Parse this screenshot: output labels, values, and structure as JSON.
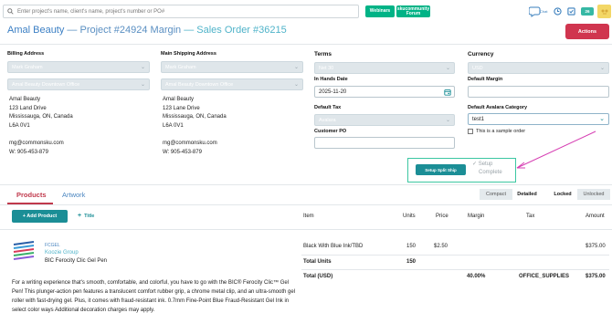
{
  "topbar": {
    "search_placeholder": "Enter project's name, client's name, project's number or PO#",
    "webinars_label": "Webinars",
    "community_label": "skucommunity Forum",
    "chat_label": "Chat",
    "badge_count": "26"
  },
  "header": {
    "client": "Amal Beauty",
    "project": " — Project #24924 Margin",
    "sales_order": " — Sales Order #36215",
    "actions_label": "Actions"
  },
  "billing": {
    "label": "Billing Address",
    "contact": "Mark Graham",
    "office": "Amal Beauty Downtown Office",
    "address": [
      "Amal Beauty",
      "123 Land Drive",
      "Mississauga, ON, Canada",
      "L6A 0V1"
    ],
    "email": "mg@commonsku.com",
    "phone": "W: 905-453-879"
  },
  "shipping": {
    "label": "Main Shipping Address",
    "contact": "Mark Graham",
    "office": "Amal Beauty Downtown Office",
    "address": [
      "Amal Beauty",
      "123 Lane Drive",
      "Mississauga, ON, Canada",
      "L6A 0V1"
    ],
    "email": "mg@commonsku.com",
    "phone": "W: 905-453-879"
  },
  "terms": {
    "label": "Terms",
    "value": "Net 30",
    "in_hands_label": "In Hands Date",
    "in_hands_value": "2025-11-20",
    "tax_label": "Default Tax",
    "tax_value": "Avalara",
    "po_label": "Customer PO",
    "po_value": ""
  },
  "currency": {
    "label": "Currency",
    "value": "USD",
    "margin_label": "Default Margin",
    "margin_value": "",
    "avalara_label": "Default Avalara Category",
    "avalara_value": "test1",
    "sample_label": "This is a sample order"
  },
  "split_ship": {
    "button": "Setup Split Ship",
    "setup_line1": "Setup",
    "setup_line2": "Complete"
  },
  "tabs": {
    "products": "Products",
    "artwork": "Artwork",
    "compact": "Compact",
    "detailed": "Detailed",
    "locked": "Locked",
    "unlocked": "Unlocked"
  },
  "toolbar": {
    "add_product": "+ Add Product",
    "add_title": "Title"
  },
  "table": {
    "headers": {
      "item": "Item",
      "units": "Units",
      "price": "Price",
      "margin": "Margin",
      "tax": "Tax",
      "amount": "Amount"
    },
    "product": {
      "code": "FCGEL",
      "supplier": "Koozie Group",
      "name": "BIC Ferocity Clic Gel Pen",
      "item": "Black With Blue Ink/TBD",
      "units": "150",
      "price": "$2.50",
      "amount": "$375.00",
      "total_units_label": "Total Units",
      "total_units": "150",
      "total_label": "Total (USD)",
      "total_margin": "40.00%",
      "total_tax": "OFFICE_SUPPLIES",
      "total_amount": "$375.00",
      "description": "For a writing experience that's smooth, comfortable, and colorful, you have to go with the BIC® Ferocity Clic™ Gel Pen! This plunger-action pen features a translucent comfort rubber grip, a chrome metal clip, and an ultra-smooth gel roller with fast-drying gel. Plus, it comes with fraud-resistant ink. 0.7mm Fine-Point Blue Fraud-Resistant Gel Ink in select color ways Additional decoration charges may apply."
    }
  },
  "colors": {
    "accent": "#1b8e96",
    "brand_red": "#d0354f",
    "link_blue": "#3b7fc4",
    "highlight_green": "#3cc7a2",
    "arrow_magenta": "#d63fb3"
  }
}
